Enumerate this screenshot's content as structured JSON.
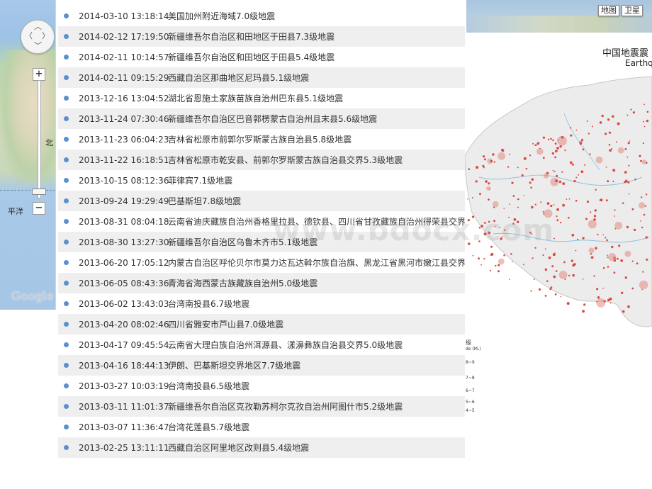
{
  "left_map": {
    "labels": {
      "north": "北",
      "ocean": "平洋"
    },
    "zoom_in": "+",
    "zoom_out": "−",
    "logo": "Google"
  },
  "earthquakes": [
    {
      "time": "2014-03-10 13:18:14",
      "desc": "美国加州附近海域7.0级地震"
    },
    {
      "time": "2014-02-12 17:19:50",
      "desc": "新疆维吾尔自治区和田地区于田县7.3级地震"
    },
    {
      "time": "2014-02-11 10:14:57",
      "desc": "新疆维吾尔自治区和田地区于田县5.4级地震"
    },
    {
      "time": "2014-02-11 09:15:29",
      "desc": "西藏自治区那曲地区尼玛县5.1级地震"
    },
    {
      "time": "2013-12-16 13:04:52",
      "desc": "湖北省恩施土家族苗族自治州巴东县5.1级地震"
    },
    {
      "time": "2013-11-24 07:30:46",
      "desc": "新疆维吾尔自治区巴音郭楞蒙古自治州且末县5.6级地震"
    },
    {
      "time": "2013-11-23 06:04:23",
      "desc": "吉林省松原市前郭尔罗斯蒙古族自治县5.8级地震"
    },
    {
      "time": "2013-11-22 16:18:51",
      "desc": "吉林省松原市乾安县、前郭尔罗斯蒙古族自治县交界5.3级地震"
    },
    {
      "time": "2013-10-15 08:12:36",
      "desc": "菲律宾7.1级地震"
    },
    {
      "time": "2013-09-24 19:29:49",
      "desc": "巴基斯坦7.8级地震"
    },
    {
      "time": "2013-08-31 08:04:18",
      "desc": "云南省迪庆藏族自治州香格里拉县、德钦县、四川省甘孜藏族自治州得荣县交界5.9"
    },
    {
      "time": "2013-08-30 13:27:30",
      "desc": "新疆维吾尔自治区乌鲁木齐市5.1级地震"
    },
    {
      "time": "2013-06-20 17:05:12",
      "desc": "内蒙古自治区呼伦贝尔市莫力达瓦达斡尔族自治旗、黑龙江省黑河市嫩江县交界5.0"
    },
    {
      "time": "2013-06-05 08:43:36",
      "desc": "青海省海西蒙古族藏族自治州5.0级地震"
    },
    {
      "time": "2013-06-02 13:43:03",
      "desc": "台湾南投县6.7级地震"
    },
    {
      "time": "2013-04-20 08:02:46",
      "desc": "四川省雅安市芦山县7.0级地震"
    },
    {
      "time": "2013-04-17 09:45:54",
      "desc": "云南省大理白族自治州洱源县、漾濞彝族自治县交界5.0级地震"
    },
    {
      "time": "2013-04-16 18:44:13",
      "desc": "伊朗、巴基斯坦交界地区7.7级地震"
    },
    {
      "time": "2013-03-27 10:03:19",
      "desc": "台湾南投县6.5级地震"
    },
    {
      "time": "2013-03-11 11:01:37",
      "desc": "新疆维吾尔自治区克孜勒苏柯尔克孜自治州阿图什市5.2级地震"
    },
    {
      "time": "2013-03-07 11:36:47",
      "desc": "台湾花莲县5.7级地震"
    },
    {
      "time": "2013-02-25 13:11:11",
      "desc": "西藏自治区阿里地区改则县5.4级地震"
    }
  ],
  "right_map": {
    "map_type_buttons": [
      "地图",
      "卫星"
    ],
    "title": "中国地震震",
    "subtitle": "Earthq",
    "legend": {
      "header": "级",
      "subheader": "de (Mₛ)",
      "ranges": [
        "8~9",
        "7~8",
        "6~7",
        "5~6",
        "4~5"
      ]
    }
  },
  "watermark": "www.bdocx.com"
}
